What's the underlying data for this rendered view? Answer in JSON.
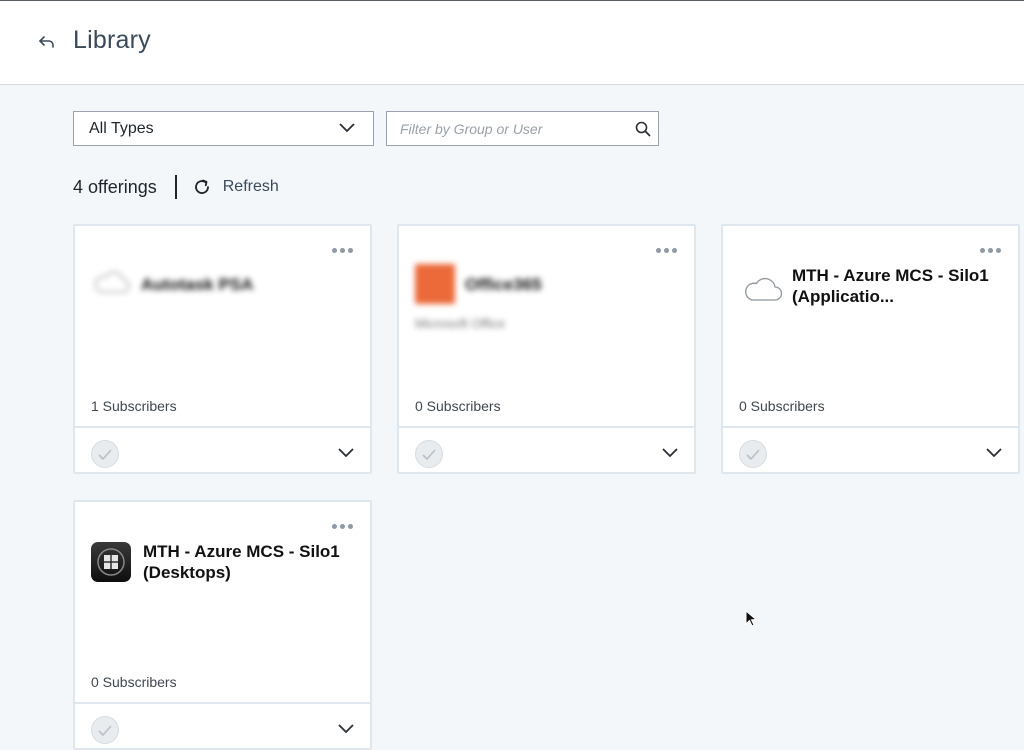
{
  "header": {
    "title": "Library"
  },
  "filters": {
    "type_select": "All Types",
    "search_placeholder": "Filter by Group or User"
  },
  "summary": {
    "count_label": "4 offerings",
    "refresh_label": "Refresh"
  },
  "cards": [
    {
      "name": "Autotask PSA",
      "subtitle": "",
      "subscribers": "1 Subscribers",
      "icon": "cloud-icon",
      "blurred": true
    },
    {
      "name": "Office365",
      "subtitle": "Microsoft Office",
      "subscribers": "0 Subscribers",
      "icon": "office-icon",
      "blurred": true
    },
    {
      "name": "MTH - Azure MCS - Silo1 (Applicatio...",
      "subtitle": "",
      "subscribers": "0 Subscribers",
      "icon": "cloud-icon",
      "blurred": false
    },
    {
      "name": "MTH - Azure MCS - Silo1 (Desktops)",
      "subtitle": "",
      "subscribers": "0 Subscribers",
      "icon": "windows-desktop-icon",
      "blurred": false
    }
  ],
  "colors": {
    "accent": "#3b4a5a",
    "office": "#ec6a3a",
    "card_border": "#dfe7ee",
    "background": "#f4f7fa"
  }
}
